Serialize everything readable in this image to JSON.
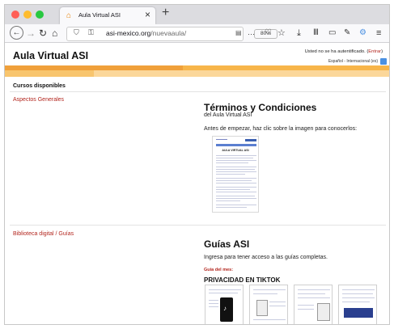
{
  "browser": {
    "tab_title": "Aula Virtual ASI",
    "tab_close": "×",
    "new_tab": "+",
    "url_host": "asi-mexico.org",
    "url_path": "/nuevaaula/",
    "zoom": "80%",
    "overflow": "···"
  },
  "site": {
    "title": "Aula Virtual ASI",
    "login_text": "Usted no se ha autentificado. (",
    "login_link": "Entrar",
    "login_close": ")",
    "language": "Español - Internacional (es)"
  },
  "courses": {
    "heading": "Cursos disponibles",
    "items": [
      {
        "name": "Aspectos Generales",
        "title": "Términos y Condiciones",
        "subtitle": "del Aula Virtual ASI",
        "text": "Antes de empezar, haz clic sobre la imagen para conocerlos:",
        "doc_title": "AULA VIRTUAL ASI"
      },
      {
        "name": "Biblioteca digital / Guías",
        "title": "Guías ASI",
        "text": "Ingresa para tener acceso a las guías completas.",
        "guide_label": "Guía del mes:",
        "guide_title": "PRIVACIDAD EN TIKTOK"
      }
    ]
  },
  "colors": {
    "accent_red": "#b3261e",
    "band_orange": "#f7b54a",
    "band_light": "#fbd79a"
  }
}
